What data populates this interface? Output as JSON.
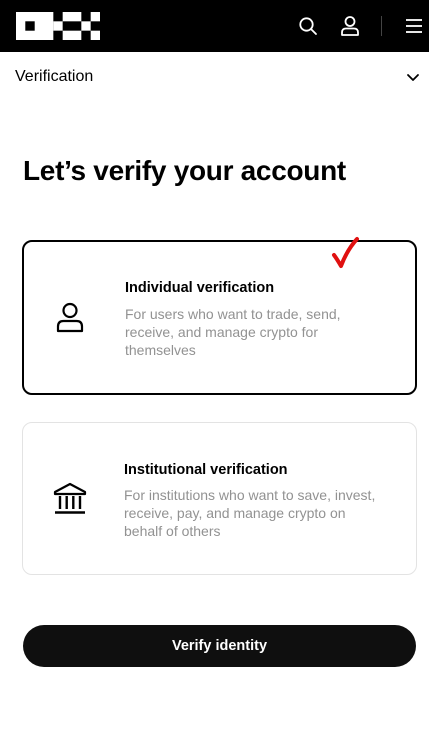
{
  "header": {
    "logo_text": "OKX",
    "icons": [
      "search-icon",
      "user-icon",
      "menu-icon"
    ]
  },
  "section": {
    "label": "Verification"
  },
  "main": {
    "title": "Let’s verify your account",
    "options": [
      {
        "title": "Individual verification",
        "description": "For users who want to trade, send, receive, and manage crypto for themselves",
        "icon": "person-icon",
        "selected": true
      },
      {
        "title": "Institutional verification",
        "description": "For institutions who want to save, invest, receive, pay, and manage crypto on behalf of others",
        "icon": "bank-icon",
        "selected": false
      }
    ],
    "primary_button_label": "Verify identity"
  },
  "annotation": {
    "selection_mark": "check-mark",
    "color": "#e01010"
  },
  "colors": {
    "header_bg": "#000000",
    "button_bg": "#0f0f0f",
    "selected_border": "#000000",
    "description_text": "#929292"
  }
}
